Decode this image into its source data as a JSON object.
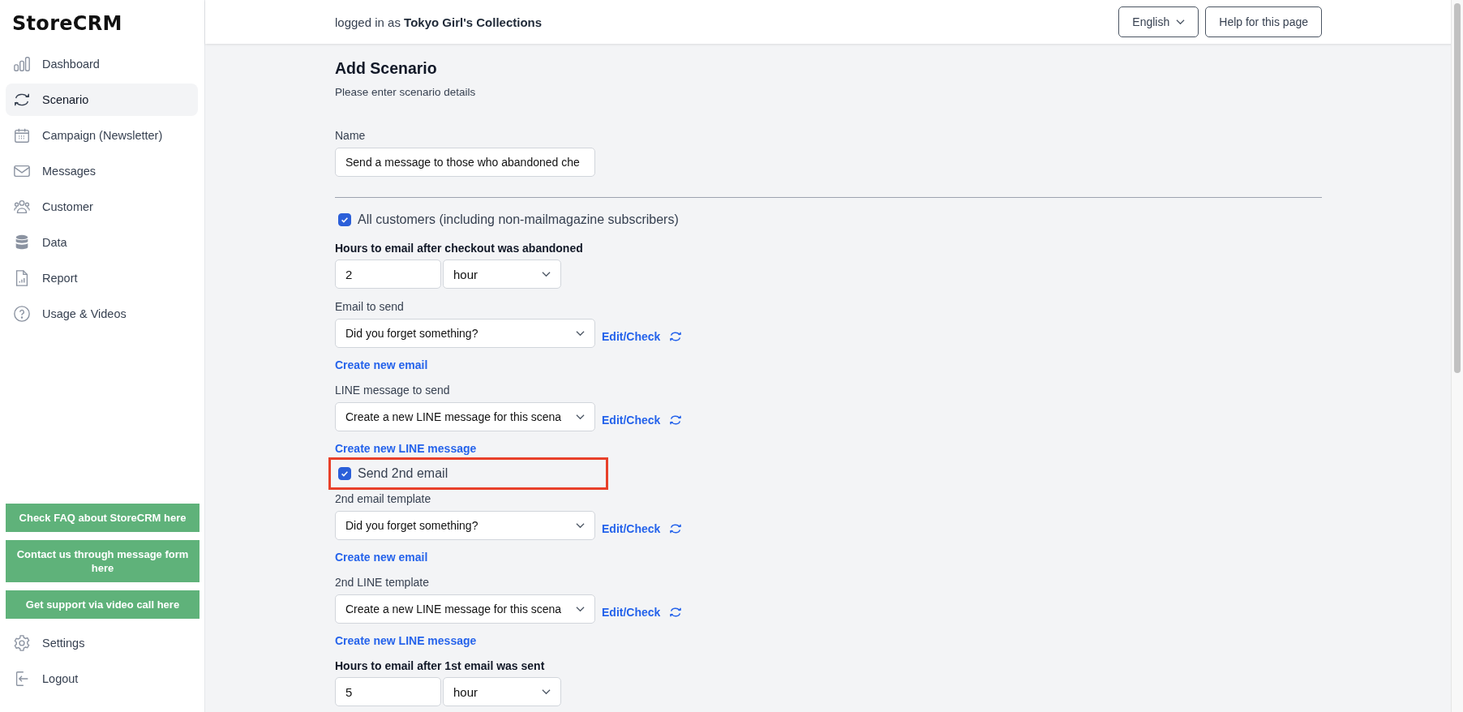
{
  "app": {
    "logo": "StoreCRM"
  },
  "sidebar": {
    "items": [
      {
        "label": "Dashboard",
        "selected": false
      },
      {
        "label": "Scenario",
        "selected": true
      },
      {
        "label": "Campaign (Newsletter)",
        "selected": false
      },
      {
        "label": "Messages",
        "selected": false
      },
      {
        "label": "Customer",
        "selected": false
      },
      {
        "label": "Data",
        "selected": false
      },
      {
        "label": "Report",
        "selected": false
      },
      {
        "label": "Usage & Videos",
        "selected": false
      }
    ],
    "support_buttons": [
      "Check FAQ about StoreCRM here",
      "Contact us through message form here",
      "Get support via video call here"
    ],
    "bottom_items": [
      {
        "label": "Settings"
      },
      {
        "label": "Logout"
      }
    ]
  },
  "header": {
    "login_prefix": "logged in as",
    "store_name": "Tokyo Girl's Collections",
    "language": "English",
    "help_button": "Help for this page"
  },
  "page": {
    "title": "Add Scenario",
    "subtitle": "Please enter scenario details"
  },
  "form": [
    {
      "kind": "text",
      "label": "Name",
      "value": "Send a message to those who abandoned che"
    },
    {
      "kind": "divider"
    },
    {
      "kind": "checkbox",
      "label": "All customers (including non-mailmagazine subscribers)",
      "checked": true,
      "highlighted": false
    },
    {
      "kind": "duration",
      "label": "Hours to email after checkout was abandoned",
      "value": "2",
      "unit": "hour"
    },
    {
      "kind": "template",
      "label": "Email to send",
      "value": "Did you forget something?",
      "action": "Edit/Check",
      "link": "Create new email"
    },
    {
      "kind": "template",
      "label": "LINE message to send",
      "value": "Create a new LINE message for this scena",
      "action": "Edit/Check",
      "link": "Create new LINE message"
    },
    {
      "kind": "checkbox",
      "label": "Send 2nd email",
      "checked": true,
      "highlighted": true
    },
    {
      "kind": "template",
      "label": "2nd email template",
      "value": "Did you forget something?",
      "action": "Edit/Check",
      "link": "Create new email"
    },
    {
      "kind": "template",
      "label": "2nd LINE template",
      "value": "Create a new LINE message for this scena",
      "action": "Edit/Check",
      "link": "Create new LINE message"
    },
    {
      "kind": "duration",
      "label": "Hours to email after 1st email was sent",
      "value": "5",
      "unit": "hour"
    }
  ]
}
